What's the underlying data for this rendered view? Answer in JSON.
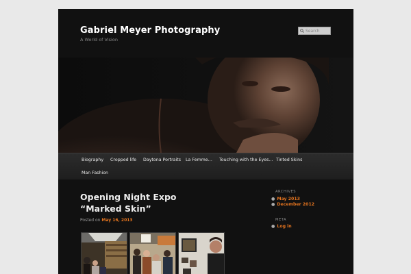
{
  "site": {
    "title": "Gabriel Meyer Photography",
    "description": "A World of Vision"
  },
  "search": {
    "placeholder": "Search"
  },
  "nav": {
    "items": [
      "Biography",
      "Cropped life",
      "Daytona Portraits",
      "La Femme…",
      "Touching with the Eyes…",
      "Tinted Skins",
      "Man Fashion"
    ]
  },
  "post": {
    "title": "Opening Night Expo “Marked Skin”",
    "posted_on": "Posted on",
    "date": "May 16, 2013"
  },
  "sidebar": {
    "archives": {
      "title": "ARCHIVES",
      "links": [
        "May 2013",
        "December 2012"
      ]
    },
    "meta": {
      "title": "META",
      "links": [
        "Log in"
      ]
    }
  },
  "colors": {
    "accent": "#e4741f",
    "page_bg": "#111111",
    "outer_bg": "#e9e9e9"
  }
}
